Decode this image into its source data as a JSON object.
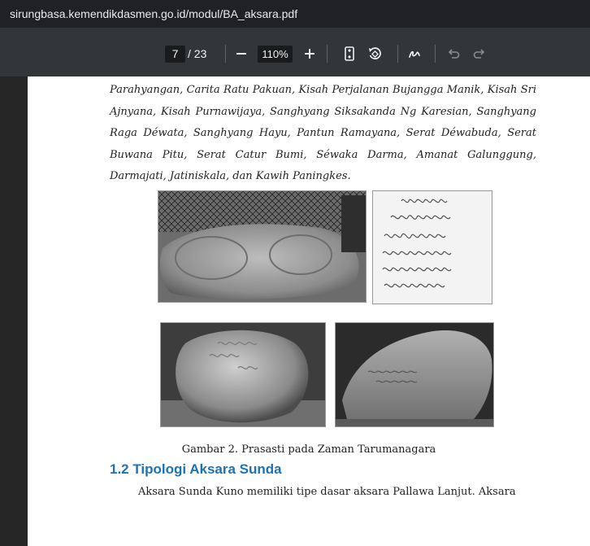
{
  "browser": {
    "url": "sirungbasa.kemendikdasmen.go.id/modul/BA_aksara.pdf"
  },
  "viewer": {
    "current_page": "7",
    "total_pages": "/ 23",
    "zoom": "110%",
    "icons": [
      "minus-icon",
      "plus-icon",
      "fit-page-icon",
      "rotate-icon",
      "draw-icon",
      "undo-icon",
      "redo-icon"
    ]
  },
  "document": {
    "paragraph": "Parahyangan, Carita Ratu Pakuan, Kisah Perjalanan Bujangga Manik, Kisah Sri Ajnyana, Kisah Purnawijaya, Sanghyang Siksakanda Ng Karesian, Sanghyang Raga Déwata, Sanghyang Hayu, Pantun Ramayana, Serat Déwabuda, Serat Buwana Pitu, Serat Catur Bumi, Séwaka Darma, Amanat Galunggung, Darmajati, Jatiniskala, dan Kawih Paningkes.",
    "figure_caption": "Gambar 2. Prasasti pada Zaman Tarumanagara",
    "section_heading": "1.2 Tipologi Aksara Sunda",
    "body_text": "Aksara Sunda Kuno memiliki tipe dasar aksara Pallawa Lanjut. Aksara"
  }
}
